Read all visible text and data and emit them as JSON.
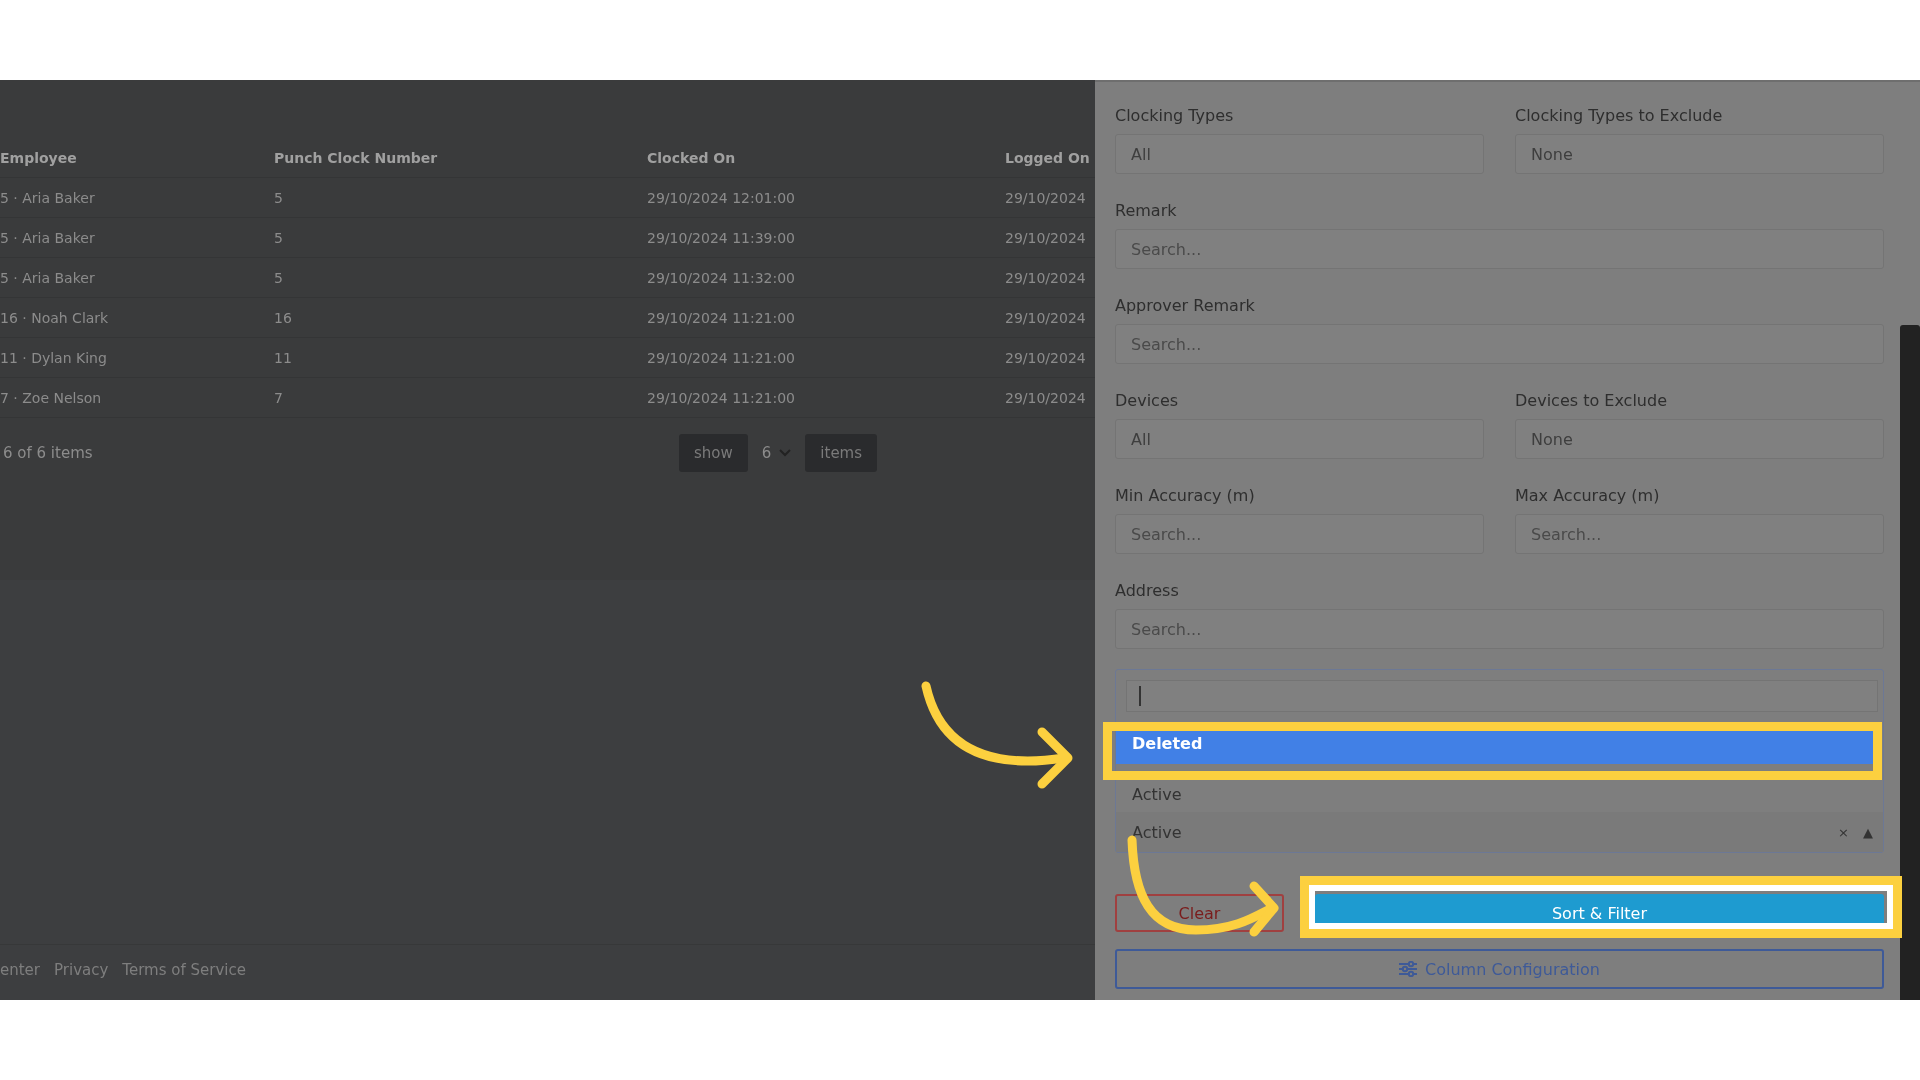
{
  "table": {
    "columns": [
      "Employee",
      "Punch Clock Number",
      "Clocked On",
      "Logged On"
    ],
    "rows": [
      {
        "cells": [
          "5 · Aria Baker",
          "5",
          "29/10/2024 12:01:00",
          "29/10/2024"
        ]
      },
      {
        "cells": [
          "5 · Aria Baker",
          "5",
          "29/10/2024 11:39:00",
          "29/10/2024"
        ]
      },
      {
        "cells": [
          "5 · Aria Baker",
          "5",
          "29/10/2024 11:32:00",
          "29/10/2024"
        ]
      },
      {
        "cells": [
          "16 · Noah Clark",
          "16",
          "29/10/2024 11:21:00",
          "29/10/2024"
        ]
      },
      {
        "cells": [
          "11 · Dylan King",
          "11",
          "29/10/2024 11:21:00",
          "29/10/2024"
        ]
      },
      {
        "cells": [
          "7 · Zoe Nelson",
          "7",
          "29/10/2024 11:21:00",
          "29/10/2024"
        ]
      }
    ],
    "summary": "6 of 6 items",
    "pager": {
      "show": "show",
      "value": "6",
      "items": "items"
    }
  },
  "footer": {
    "links": [
      "enter",
      "Privacy",
      "Terms of Service"
    ]
  },
  "filter_panel": {
    "rows": [
      [
        {
          "label": "Clocking Types",
          "value": "All"
        },
        {
          "label": "Clocking Types to Exclude",
          "value": "None"
        }
      ],
      [
        {
          "label": "Remark",
          "placeholder": "Search..."
        }
      ],
      [
        {
          "label": "Approver Remark",
          "placeholder": "Search..."
        }
      ],
      [
        {
          "label": "Devices",
          "value": "All"
        },
        {
          "label": "Devices to Exclude",
          "value": "None"
        }
      ],
      [
        {
          "label": "Min Accuracy (m)",
          "placeholder": "Search..."
        },
        {
          "label": "Max Accuracy (m)",
          "placeholder": "Search..."
        }
      ],
      [
        {
          "label": "Address",
          "placeholder": "Search..."
        }
      ]
    ],
    "status_select": {
      "expanded": true,
      "options": [
        {
          "label": "Deleted",
          "highlighted": true
        },
        {
          "label": "Active",
          "highlighted": false
        }
      ],
      "value": "Active",
      "clear": "×",
      "caret": "▲"
    },
    "clear_button": "Clear",
    "apply_button": "Sort & Filter",
    "column_button": "Column Configuration"
  }
}
